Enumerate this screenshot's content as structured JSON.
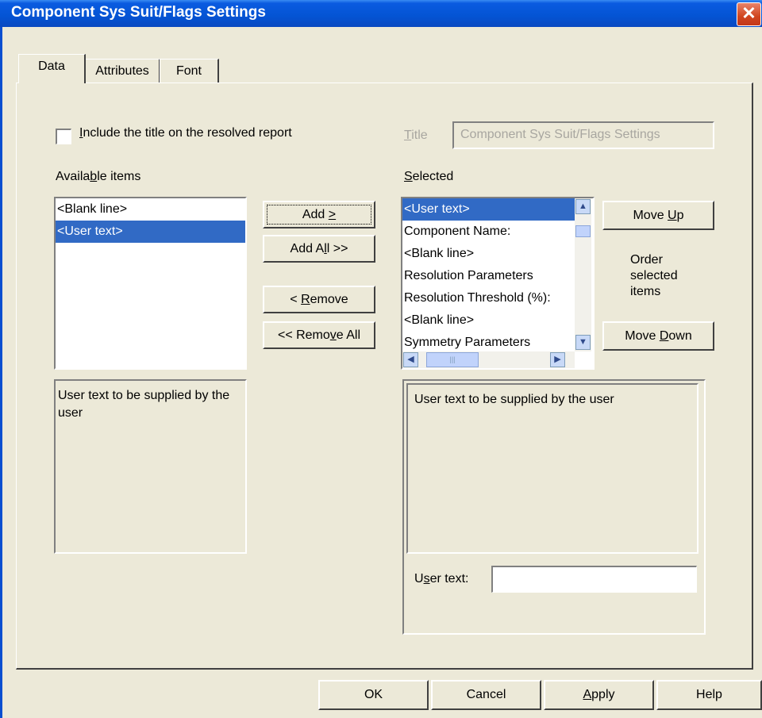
{
  "window": {
    "title": "Component Sys Suit/Flags Settings",
    "close_glyph": "✕"
  },
  "tabs": [
    {
      "label": "Data"
    },
    {
      "label": "Attributes"
    },
    {
      "label": "Font"
    }
  ],
  "include_title": {
    "label_prefix": "",
    "label_u": "I",
    "label_rest": "nclude the title on the resolved report",
    "checked": false
  },
  "title_field": {
    "label_u": "T",
    "label_rest": "itle",
    "value": "Component Sys Suit/Flags Settings"
  },
  "available": {
    "heading_pre": "Availa",
    "heading_u": "b",
    "heading_post": "le items",
    "items": [
      "<Blank line>",
      "<User text>"
    ],
    "selected_index": 1,
    "description": "User text to be supplied by the user"
  },
  "transfer_buttons": {
    "add_pre": "Add ",
    "add_u": ">",
    "addall_pre": "Add A",
    "addall_u": "l",
    "addall_post": "l >>",
    "remove_pre": "< ",
    "remove_u": "R",
    "remove_post": "emove",
    "removeall_pre": "<< Remo",
    "removeall_u": "v",
    "removeall_post": "e All"
  },
  "selected": {
    "heading_u": "S",
    "heading_rest": "elected",
    "items": [
      "<User text>",
      "Component Name:",
      "<Blank line>",
      "Resolution Parameters",
      "Resolution Threshold (%):",
      "<Blank line>",
      "Symmetry Parameters"
    ],
    "selected_index": 0,
    "description": "User text to be supplied by the user",
    "user_text_label_pre": "U",
    "user_text_label_u": "s",
    "user_text_label_post": "er text:",
    "user_text_value": ""
  },
  "order": {
    "move_up_pre": "Move ",
    "move_up_u": "U",
    "move_up_post": "p",
    "hint_line1": "Order",
    "hint_line2": "selected",
    "hint_line3": "items",
    "move_down_pre": "Move ",
    "move_down_u": "D",
    "move_down_post": "own"
  },
  "footer": {
    "ok": "OK",
    "cancel": "Cancel",
    "apply_u": "A",
    "apply_rest": "pply",
    "help": "Help"
  }
}
